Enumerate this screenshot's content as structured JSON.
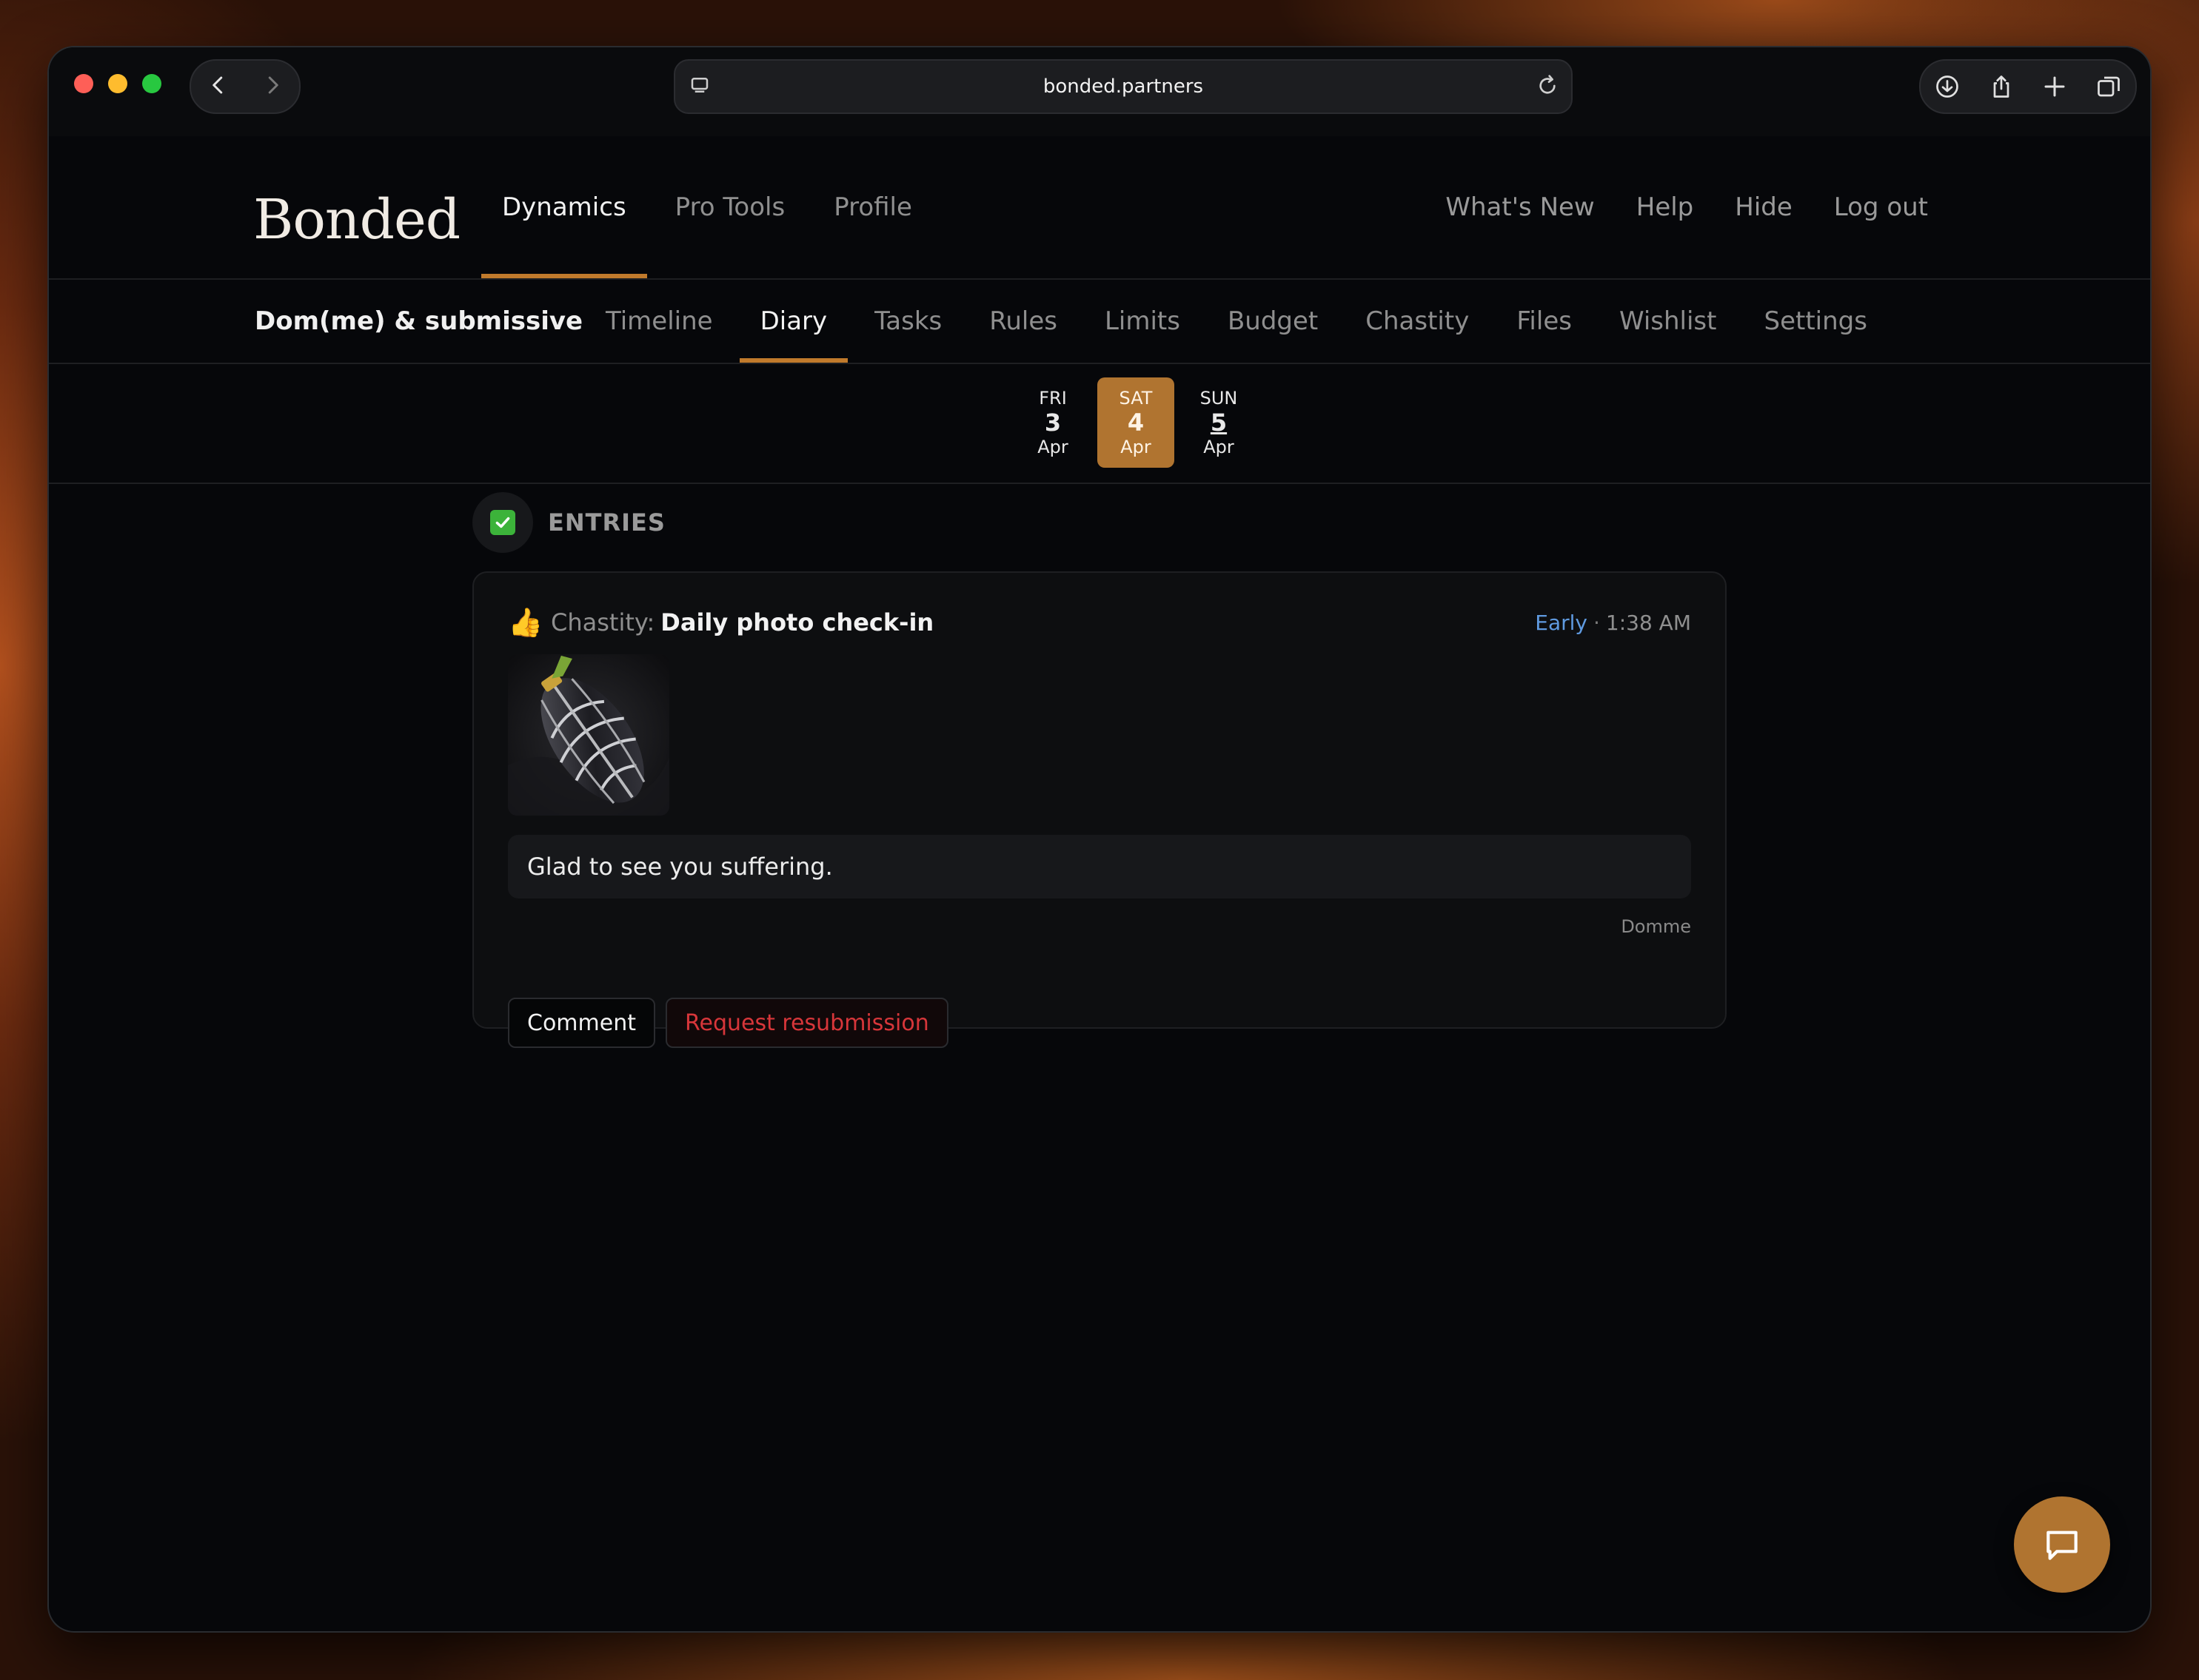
{
  "browser": {
    "url": "bonded.partners"
  },
  "brand": {
    "logo_text": "Bonded"
  },
  "main_nav": [
    {
      "label": "Dynamics",
      "active": true
    },
    {
      "label": "Pro Tools",
      "active": false
    },
    {
      "label": "Profile",
      "active": false
    }
  ],
  "right_nav": [
    "What's New",
    "Help",
    "Hide",
    "Log out"
  ],
  "dynamic": {
    "title": "Dom(me) & submissive"
  },
  "tabs": [
    {
      "label": "Timeline",
      "active": false
    },
    {
      "label": "Diary",
      "active": true
    },
    {
      "label": "Tasks",
      "active": false
    },
    {
      "label": "Rules",
      "active": false
    },
    {
      "label": "Limits",
      "active": false
    },
    {
      "label": "Budget",
      "active": false
    },
    {
      "label": "Chastity",
      "active": false
    },
    {
      "label": "Files",
      "active": false
    },
    {
      "label": "Wishlist",
      "active": false
    },
    {
      "label": "Settings",
      "active": false
    }
  ],
  "dates": [
    {
      "dow": "FRI",
      "num": "3",
      "mon": "Apr",
      "active": false
    },
    {
      "dow": "SAT",
      "num": "4",
      "mon": "Apr",
      "active": true
    },
    {
      "dow": "SUN",
      "num": "5",
      "mon": "Apr",
      "active": false
    }
  ],
  "entries": {
    "section_label": "ENTRIES",
    "items": [
      {
        "category": "Chastity:",
        "title": "Daily photo check-in",
        "status": "Early",
        "separator": "·",
        "time": "1:38 AM",
        "comment": "Glad to see you suffering.",
        "comment_author": "Domme",
        "actions": {
          "comment": "Comment",
          "resubmit": "Request resubmission"
        }
      }
    ]
  },
  "colors": {
    "accent": "#b07430",
    "status_early": "#5f9ae0",
    "danger": "#d7363a",
    "background": "#06070a"
  },
  "icons": {
    "back": "chevron-left-icon",
    "forward": "chevron-right-icon",
    "reader": "reader-icon",
    "reload": "reload-icon",
    "download": "download-icon",
    "share": "share-icon",
    "new_tab": "plus-icon",
    "tabs": "tabs-overview-icon",
    "entries": "checkmark-icon",
    "reaction": "thumbs-up-icon",
    "chat": "chat-bubble-icon"
  }
}
